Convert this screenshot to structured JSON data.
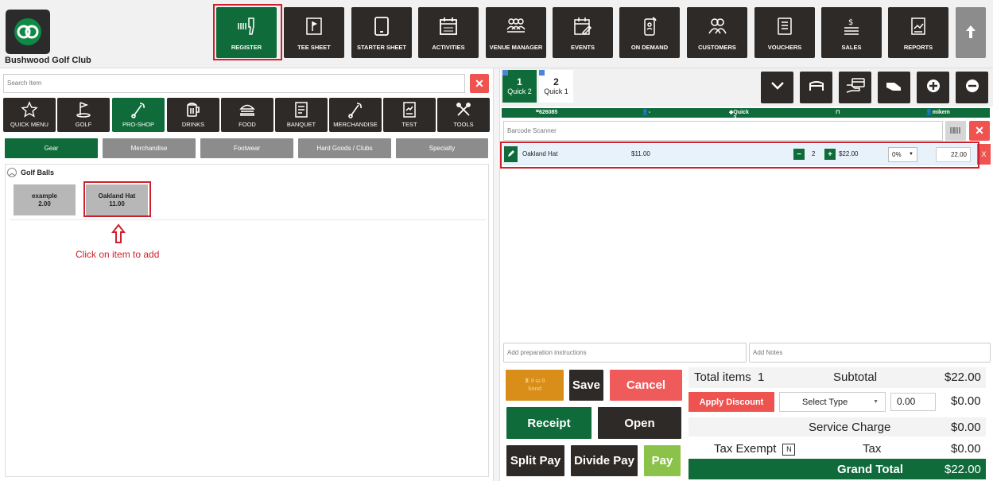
{
  "header": {
    "club_name": "Bushwood Golf Club",
    "nav": [
      {
        "label": "REGISTER",
        "icon": "barcode-scanner-icon",
        "active": true
      },
      {
        "label": "TEE SHEET",
        "icon": "flag-sheet-icon"
      },
      {
        "label": "STARTER SHEET",
        "icon": "tablet-icon"
      },
      {
        "label": "ACTIVITIES",
        "icon": "calendar-icon"
      },
      {
        "label": "VENUE MANAGER",
        "icon": "people-icon"
      },
      {
        "label": "EVENTS",
        "icon": "event-calendar-icon"
      },
      {
        "label": "ON DEMAND",
        "icon": "mobile-icon"
      },
      {
        "label": "CUSTOMERS",
        "icon": "customers-icon"
      },
      {
        "label": "VOUCHERS",
        "icon": "voucher-icon"
      },
      {
        "label": "SALES",
        "icon": "sales-icon"
      },
      {
        "label": "REPORTS",
        "icon": "report-icon"
      }
    ]
  },
  "left": {
    "search_placeholder": "Search Item",
    "categories": [
      {
        "label": "QUICK MENU",
        "icon": "star-icon"
      },
      {
        "label": "GOLF",
        "icon": "golf-icon"
      },
      {
        "label": "PRO-SHOP",
        "icon": "pro-shop-icon",
        "active": true
      },
      {
        "label": "DRINKS",
        "icon": "drinks-icon"
      },
      {
        "label": "FOOD",
        "icon": "burger-icon"
      },
      {
        "label": "BANQUET",
        "icon": "banquet-icon"
      },
      {
        "label": "MERCHANDISE",
        "icon": "merchandise-icon"
      },
      {
        "label": "TEST",
        "icon": "test-icon"
      },
      {
        "label": "TOOLS",
        "icon": "tools-icon"
      }
    ],
    "subcategories": [
      {
        "label": "Gear",
        "active": true
      },
      {
        "label": "Merchandise"
      },
      {
        "label": "Footwear"
      },
      {
        "label": "Hard Goods / Clubs"
      },
      {
        "label": "Specialty"
      }
    ],
    "group_title": "Golf Balls",
    "items": [
      {
        "name": "example",
        "price": "2.00"
      },
      {
        "name": "Oakland Hat",
        "price": "11.00"
      }
    ],
    "hint": "Click on item to add"
  },
  "order": {
    "tabs": [
      {
        "num": "1",
        "label": "Quick 2",
        "active": true
      },
      {
        "num": "2",
        "label": "Quick 1"
      }
    ],
    "info": {
      "ticket": "626085",
      "customer": "-",
      "tab": "Quick 2",
      "user": "mikem"
    },
    "barcode_placeholder": "Barcode Scanner",
    "line": {
      "name": "Oakland Hat",
      "price": "$11.00",
      "qty": "2",
      "total": "$22.00",
      "discount": "0%",
      "amount": "22.00",
      "remove": "X"
    },
    "prep_placeholder": "Add preparation instructions",
    "notes_placeholder": "Add Notes",
    "buttons": {
      "send": "Send",
      "save": "Save",
      "cancel": "Cancel",
      "receipt": "Receipt",
      "open": "Open",
      "split_pay": "Split Pay",
      "divide_pay": "Divide Pay",
      "pay": "Pay"
    },
    "totals": {
      "total_items_label": "Total items",
      "total_items": "1",
      "subtotal_label": "Subtotal",
      "subtotal": "$22.00",
      "apply_discount": "Apply Discount",
      "select_type": "Select Type",
      "discount_value": "0.00",
      "discount_amount": "$0.00",
      "service_charge_label": "Service Charge",
      "service_charge": "$0.00",
      "tax_exempt_label": "Tax Exempt",
      "tax_exempt_flag": "N",
      "tax_label": "Tax",
      "tax": "$0.00",
      "grand_total_label": "Grand Total",
      "grand_total": "$22.00"
    }
  },
  "colors": {
    "brand_green": "#0f6b3a",
    "dark": "#2e2a27",
    "danger": "#ef5350",
    "highlight": "#d0202c",
    "pay_green": "#8bc34a",
    "send_orange": "#d98e1a"
  }
}
